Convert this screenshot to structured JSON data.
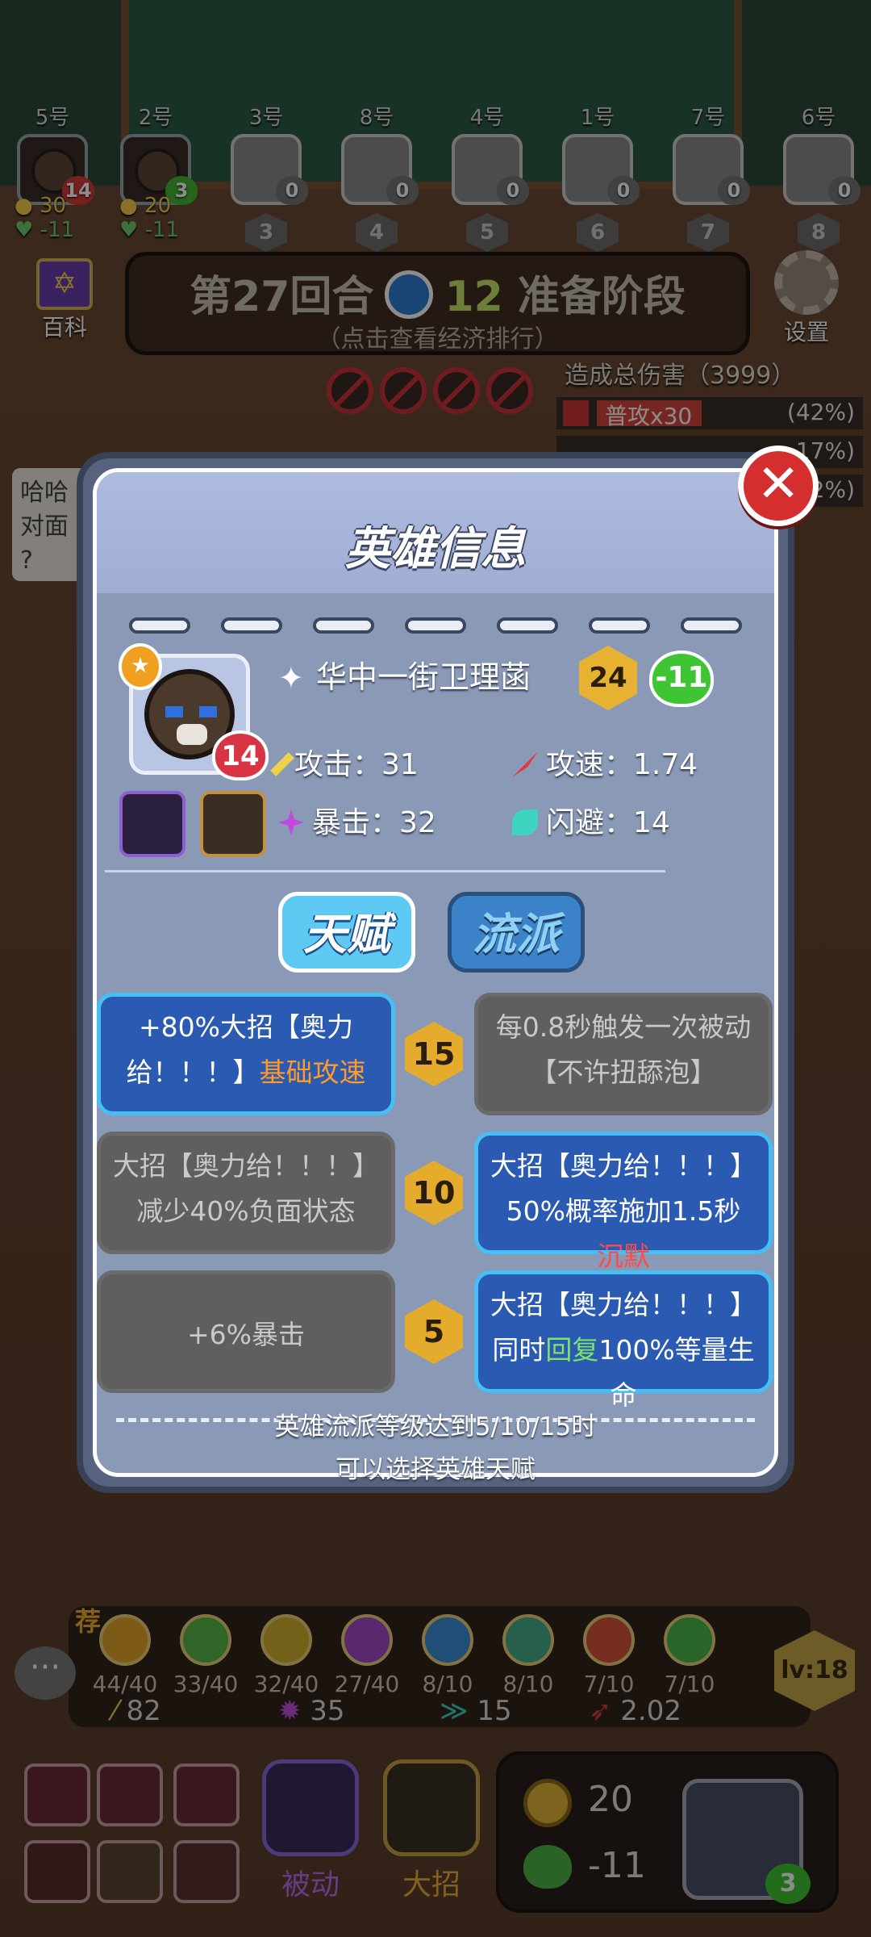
{
  "players": [
    {
      "seat": "5号",
      "hp": "14",
      "rank": ""
    },
    {
      "seat": "2号",
      "hp": "3",
      "rank": ""
    },
    {
      "seat": "3号",
      "hp": "0",
      "rank": "3"
    },
    {
      "seat": "8号",
      "hp": "0",
      "rank": "4"
    },
    {
      "seat": "4号",
      "hp": "0",
      "rank": "5"
    },
    {
      "seat": "1号",
      "hp": "0",
      "rank": "6"
    },
    {
      "seat": "7号",
      "hp": "0",
      "rank": "7"
    },
    {
      "seat": "6号",
      "hp": "0",
      "rank": "8"
    }
  ],
  "player_stats": {
    "p1_gold": "30",
    "p1_hp": "-11",
    "p2_gold": "20",
    "p2_hp": "-11"
  },
  "header": {
    "wiki_label": "百科",
    "round_text": "第27回合",
    "timer": "12",
    "phase": "准备阶段",
    "sub_hint": "（点击查看经济排行）",
    "settings_label": "设置"
  },
  "damage": {
    "title": "造成总伤害（3999）",
    "row1_name": "普攻x30",
    "row1_pct": "(42%)",
    "row2_pct": "17%)",
    "row3_pct": "2%)"
  },
  "bubble": {
    "l1": "哈哈",
    "l2": "对面",
    "l3": "?"
  },
  "modal": {
    "title": "英雄信息",
    "close": "✕",
    "hero_name": "华中一街卫理菡",
    "star": "✦",
    "shield": "★",
    "level": "24",
    "hp_badge": "-11",
    "portrait_hp": "14",
    "stats": {
      "atk": "攻击：31",
      "aspd": "攻速：1.74",
      "crit": "暴击：32",
      "dodge": "闪避：14"
    },
    "tabs": {
      "talent": "天赋",
      "school": "流派"
    },
    "talents": [
      {
        "level": "15",
        "left_a": "+80%大招【奥力给！！！】",
        "left_b": "基础攻速",
        "right": "每0.8秒触发一次被动【不许扭舔泡】"
      },
      {
        "level": "10",
        "left": "大招【奥力给！！！】减少40%负面状态",
        "right_a": "大招【奥力给！！！】50%概率施加1.5秒",
        "right_b": "沉默"
      },
      {
        "level": "5",
        "left": "+6%暴击",
        "right_a": "大招【奥力给！！！】同时",
        "right_b": "回复",
        "right_c": "100%等量生命"
      }
    ],
    "note1": "英雄流派等级达到5/10/15时",
    "note2": "可以选择英雄天赋"
  },
  "traits": [
    {
      "count": "44/40",
      "color": "#e6a52a"
    },
    {
      "count": "33/40",
      "color": "#59b84a"
    },
    {
      "count": "32/40",
      "color": "#d2b02e"
    },
    {
      "count": "27/40",
      "color": "#a549c9"
    },
    {
      "count": "8/10",
      "color": "#3b8fd8"
    },
    {
      "count": "8/10",
      "color": "#46b08a"
    },
    {
      "count": "7/10",
      "color": "#d8553b"
    },
    {
      "count": "7/10",
      "color": "#4bb64a"
    }
  ],
  "trait_sums": {
    "atk": "82",
    "crit": "35",
    "dodge": "15",
    "aspd": "2.02"
  },
  "recommend": "荐",
  "level_badge": "lv:18",
  "chat": "···",
  "skills": {
    "passive": "被动",
    "ult": "大招"
  },
  "self": {
    "gold": "20",
    "hp": "-11",
    "hp_badge": "3"
  },
  "colors": {
    "accent_blue": "#45bff4",
    "gold": "#e4ab2c",
    "red": "#d42e2e"
  }
}
